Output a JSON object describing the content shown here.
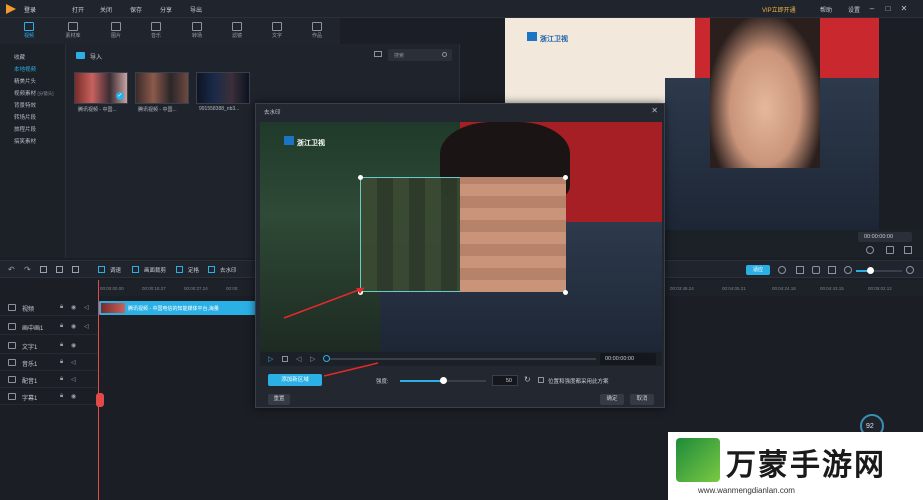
{
  "titlebar": {
    "login": "登录",
    "menu": [
      "打开",
      "关闭",
      "保存",
      "分享",
      "导出"
    ],
    "vip": "VIP立即开通",
    "help": "帮助",
    "settings": "设置"
  },
  "toolbar": {
    "tools": [
      "视频",
      "素材库",
      "图片",
      "音乐",
      "转场",
      "滤镜",
      "文字",
      "作品"
    ]
  },
  "library": {
    "sidebar": [
      "收藏",
      "本地视频",
      "精美片头",
      "视频素材",
      "背景特效",
      "转场片段",
      "旅程片段",
      "搞笑素材"
    ],
    "sidebar_tag": "[分镜头]",
    "import_label": "导入",
    "search_placeholder": "搜索",
    "items": [
      {
        "label": "腾讯视频 - 中国..."
      },
      {
        "label": "腾讯视频 - 中国..."
      },
      {
        "label": "991558388_nb3..."
      }
    ]
  },
  "preview": {
    "channel_logo": "浙江卫视",
    "time": "00:00:00:00",
    "fit_label": "适应"
  },
  "timeline_tools": [
    "调速",
    "画面裁剪",
    "定格",
    "去水印"
  ],
  "ruler_ticks": [
    "00:00:00.00",
    "00:00:18.27",
    "00:00:37.24",
    "00:00:",
    "00:03:48.24",
    "00:04:05.21",
    "00:04:24.18",
    "00:04:43.15",
    "00:05:02.12"
  ],
  "tracks": [
    {
      "name": "视频"
    },
    {
      "name": "画中画1"
    },
    {
      "name": "文字1"
    },
    {
      "name": "音乐1"
    },
    {
      "name": "配音1"
    },
    {
      "name": "字幕1"
    }
  ],
  "clip": {
    "label": "腾讯视频 - 中国电信的知能媒体平台,海量"
  },
  "dialog": {
    "title": "去水印",
    "channel_logo": "浙江卫视",
    "time": "00:00:00:00",
    "add_area": "添加新区域",
    "intensity_label": "强度:",
    "intensity_value": "50",
    "intensity_fraction": 0.5,
    "checkbox_label": "位置和强度都采用此方案",
    "reset": "重置",
    "confirm": "确定",
    "cancel": "取消"
  },
  "zoom": {
    "percent": "92"
  },
  "watermark": {
    "brand": "万蒙手游网",
    "url": "www.wanmengdianlan.com"
  },
  "colors": {
    "accent": "#2bb0e6",
    "vip": "#f0b443",
    "playhead": "#e24a4a"
  }
}
